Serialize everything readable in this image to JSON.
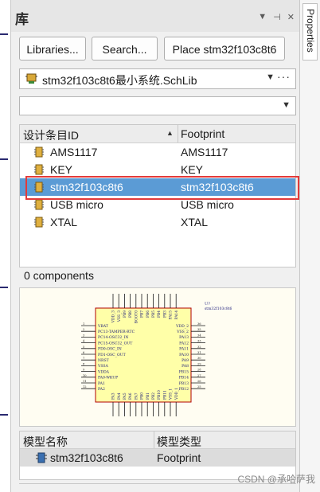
{
  "panel": {
    "title": "库",
    "icons": [
      "dropdown-icon",
      "pin-icon",
      "close-icon"
    ]
  },
  "toolbar": {
    "libraries_label": "Libraries...",
    "search_label": "Search...",
    "place_label": "Place stm32f103c8t6"
  },
  "library_combo": {
    "value": "stm32f103c8t6最小系统.SchLib",
    "more": "···"
  },
  "filter": {
    "value": ""
  },
  "component_list": {
    "headers": [
      "设计条目ID",
      "Footprint"
    ],
    "rows": [
      {
        "name": "AMS1117",
        "footprint": "AMS1117"
      },
      {
        "name": "KEY",
        "footprint": "KEY"
      },
      {
        "name": "stm32f103c8t6",
        "footprint": "stm32f103c8t6"
      },
      {
        "name": "USB micro",
        "footprint": "USB micro"
      },
      {
        "name": "XTAL",
        "footprint": "XTAL"
      }
    ],
    "selected_index": 2
  },
  "status": {
    "components": "0 components"
  },
  "preview": {
    "designator": "U?",
    "comment": "stm32f103c8t6",
    "left_pins": [
      "VBAT",
      "PC13-TAMPER-RTC",
      "PC14-OSC32_IN",
      "PC15-OSC32_OUT",
      "PD0-OSC_IN",
      "PD1-OSC_OUT",
      "NRST",
      "VSSA",
      "VDDA",
      "PA0-WKUP",
      "PA1",
      "PA2"
    ],
    "right_pins": [
      "VDD_2",
      "VSS_2",
      "PA13",
      "PA12",
      "PA11",
      "PA10",
      "PA9",
      "PA8",
      "PB15",
      "PB14",
      "PB13",
      "PB12"
    ],
    "top_pins": [
      "VDD_3",
      "VSS_3",
      "PB9",
      "PB8",
      "BOOT0",
      "PB7",
      "PB6",
      "PB5",
      "PB4",
      "PB3",
      "PA15",
      "PA14"
    ],
    "bottom_pins": [
      "PA3",
      "PA4",
      "PA5",
      "PA6",
      "PA7",
      "PB0",
      "PB1",
      "PB2",
      "PB10",
      "PB11",
      "VSS_1",
      "VDD_1"
    ],
    "right_pin_numbers": [
      "36",
      "35",
      "34",
      "33",
      "32",
      "31",
      "30",
      "29",
      "28",
      "27",
      "26",
      "25"
    ],
    "left_pin_numbers": [
      "1",
      "2",
      "3",
      "4",
      "5",
      "6",
      "7",
      "8",
      "9",
      "10",
      "11",
      "12"
    ],
    "body_color": "#ffffa8",
    "pin_color": "#1a1a1a",
    "label_color": "#1a1a7a"
  },
  "models": {
    "headers": [
      "模型名称",
      "模型类型"
    ],
    "rows": [
      {
        "name": "stm32f103c8t6",
        "type": "Footprint"
      }
    ]
  },
  "right_panel": {
    "tab": "Properties"
  },
  "watermark": "CSDN @承哈萨我",
  "colors": {
    "selection": "#5b9bd5",
    "highlight": "#e23a3a"
  }
}
